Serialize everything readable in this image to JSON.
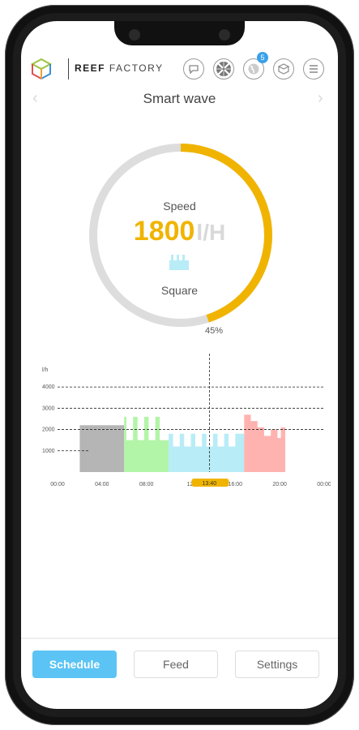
{
  "brand": {
    "bold": "REEF",
    "rest": " FACTORY"
  },
  "header": {
    "notification_count": "5"
  },
  "page": {
    "title": "Smart wave"
  },
  "gauge": {
    "label": "Speed",
    "value": "1800",
    "unit": "l/H",
    "mode": "Square",
    "percent_label": "45%",
    "percent": 45,
    "accent": "#f0b400",
    "track": "#dddddd"
  },
  "chart_data": {
    "type": "area",
    "ylabel": "l/h",
    "yticks": [
      1000,
      2000,
      3000,
      4000
    ],
    "ylim": [
      0,
      4500
    ],
    "xticks": [
      "00:00",
      "04:00",
      "08:00",
      "12:",
      "16:00",
      "20:00",
      "00:00"
    ],
    "xlim": [
      0,
      24
    ],
    "current_time": "13:40",
    "current_hour": 13.67,
    "dashed_lines": [
      2000,
      3000,
      4000
    ],
    "segments": [
      {
        "start": 2,
        "end": 6,
        "color": "#b5b5b5",
        "points": [
          [
            2,
            2200
          ],
          [
            6,
            2200
          ]
        ]
      },
      {
        "start": 6,
        "end": 10,
        "color": "#b3f5a8",
        "points": [
          [
            6,
            2600
          ],
          [
            6.2,
            2600
          ],
          [
            6.2,
            1500
          ],
          [
            6.8,
            1500
          ],
          [
            6.8,
            2600
          ],
          [
            7.2,
            2600
          ],
          [
            7.2,
            1500
          ],
          [
            7.8,
            1500
          ],
          [
            7.8,
            2600
          ],
          [
            8.2,
            2600
          ],
          [
            8.2,
            1500
          ],
          [
            8.8,
            1500
          ],
          [
            8.8,
            2600
          ],
          [
            9.2,
            2600
          ],
          [
            9.2,
            1500
          ],
          [
            10,
            1500
          ]
        ]
      },
      {
        "start": 10,
        "end": 16.8,
        "color": "#b8ecf7",
        "points": [
          [
            10,
            1800
          ],
          [
            10.4,
            1800
          ],
          [
            10.4,
            1200
          ],
          [
            11,
            1200
          ],
          [
            11,
            1800
          ],
          [
            11.4,
            1800
          ],
          [
            11.4,
            1200
          ],
          [
            12,
            1200
          ],
          [
            12,
            1800
          ],
          [
            12.4,
            1800
          ],
          [
            12.4,
            1200
          ],
          [
            13,
            1200
          ],
          [
            13,
            1800
          ],
          [
            13.4,
            1800
          ],
          [
            13.4,
            1200
          ],
          [
            14,
            1200
          ],
          [
            14,
            1800
          ],
          [
            14.4,
            1800
          ],
          [
            14.4,
            1200
          ],
          [
            15,
            1200
          ],
          [
            15,
            1800
          ],
          [
            15.4,
            1800
          ],
          [
            15.4,
            1200
          ],
          [
            16,
            1200
          ],
          [
            16,
            1800
          ],
          [
            16.8,
            1800
          ]
        ]
      },
      {
        "start": 16.8,
        "end": 20.5,
        "color": "#ffb3b0",
        "points": [
          [
            16.8,
            2700
          ],
          [
            17.4,
            2700
          ],
          [
            17.4,
            2400
          ],
          [
            18,
            2400
          ],
          [
            18,
            2100
          ],
          [
            18.6,
            2100
          ],
          [
            18.6,
            1700
          ],
          [
            19.2,
            1700
          ],
          [
            19.2,
            2000
          ],
          [
            19.8,
            2000
          ],
          [
            19.8,
            1600
          ],
          [
            20.1,
            1600
          ],
          [
            20.1,
            2100
          ],
          [
            20.5,
            2100
          ]
        ]
      }
    ]
  },
  "footer": {
    "schedule": "Schedule",
    "feed": "Feed",
    "settings": "Settings"
  }
}
